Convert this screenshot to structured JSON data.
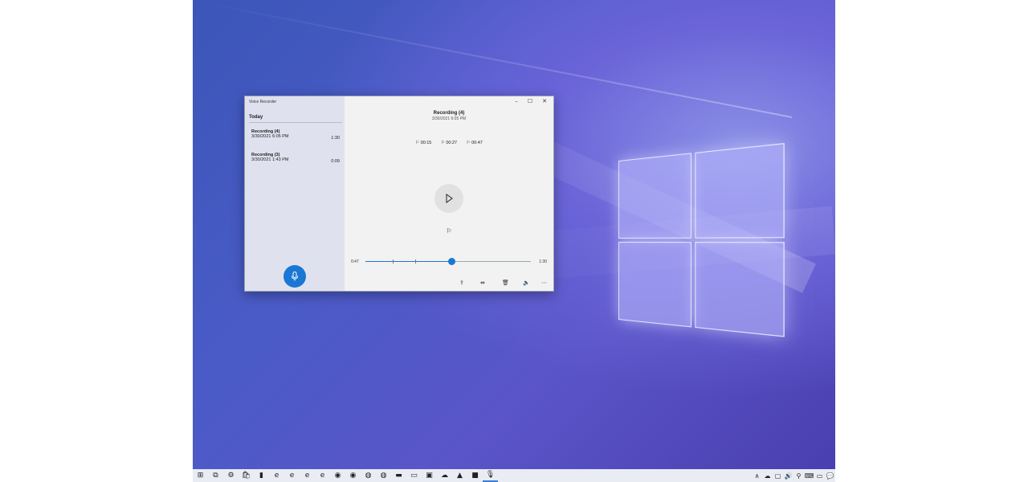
{
  "window": {
    "title": "Voice Recorder",
    "controls": {
      "minimize": "–",
      "maximize": "☐",
      "close": "✕"
    }
  },
  "sidebar": {
    "group": "Today",
    "recordings": [
      {
        "name": "Recording (4)",
        "date": "3/30/2021 6:05 PM",
        "duration": "1:30"
      },
      {
        "name": "Recording (3)",
        "date": "3/30/2021 1:43 PM",
        "duration": "0:09"
      }
    ],
    "record_button": {
      "icon": "mic-icon"
    }
  },
  "player": {
    "title": "Recording (4)",
    "date": "3/30/2021 6:05 PM",
    "markers": [
      "⚐ 00:15",
      "⚐ 00:27",
      "⚐ 00:47"
    ],
    "play_icon": "play-icon",
    "flag_icon": "flag-icon",
    "current_time": "0:47",
    "total_time": "1:30",
    "progress": 0.52
  },
  "toolbar": {
    "share": "share-icon",
    "trim": "trim-icon",
    "delete": "delete-icon",
    "speaker": "speaker-icon",
    "more": "⋯"
  },
  "taskbar": {
    "accent": "#3a7bd5",
    "apps": [
      {
        "name": "start",
        "glyph": "⊞"
      },
      {
        "name": "task-view",
        "glyph": "⧉"
      },
      {
        "name": "settings",
        "glyph": "⚙"
      },
      {
        "name": "store",
        "glyph": "🛍"
      },
      {
        "name": "phone",
        "glyph": "▮"
      },
      {
        "name": "edge",
        "glyph": "e"
      },
      {
        "name": "edge-beta",
        "glyph": "e"
      },
      {
        "name": "edge-dev",
        "glyph": "e"
      },
      {
        "name": "edge-canary",
        "glyph": "e"
      },
      {
        "name": "chrome",
        "glyph": "◉"
      },
      {
        "name": "chrome-canary",
        "glyph": "◉"
      },
      {
        "name": "firefox",
        "glyph": "◍"
      },
      {
        "name": "firefox-nightly",
        "glyph": "◍"
      },
      {
        "name": "file-explorer",
        "glyph": "▬"
      },
      {
        "name": "terminal",
        "glyph": "▭"
      },
      {
        "name": "remote-desktop",
        "glyph": "▣"
      },
      {
        "name": "onedrive",
        "glyph": "☁"
      },
      {
        "name": "photos",
        "glyph": "▲"
      },
      {
        "name": "cmd",
        "glyph": "■"
      },
      {
        "name": "voice-recorder",
        "glyph": "🎙"
      }
    ],
    "tray": [
      "∧",
      "☁",
      "▢",
      "🔊",
      "⚲",
      "⌨",
      "▭",
      "💬"
    ]
  }
}
